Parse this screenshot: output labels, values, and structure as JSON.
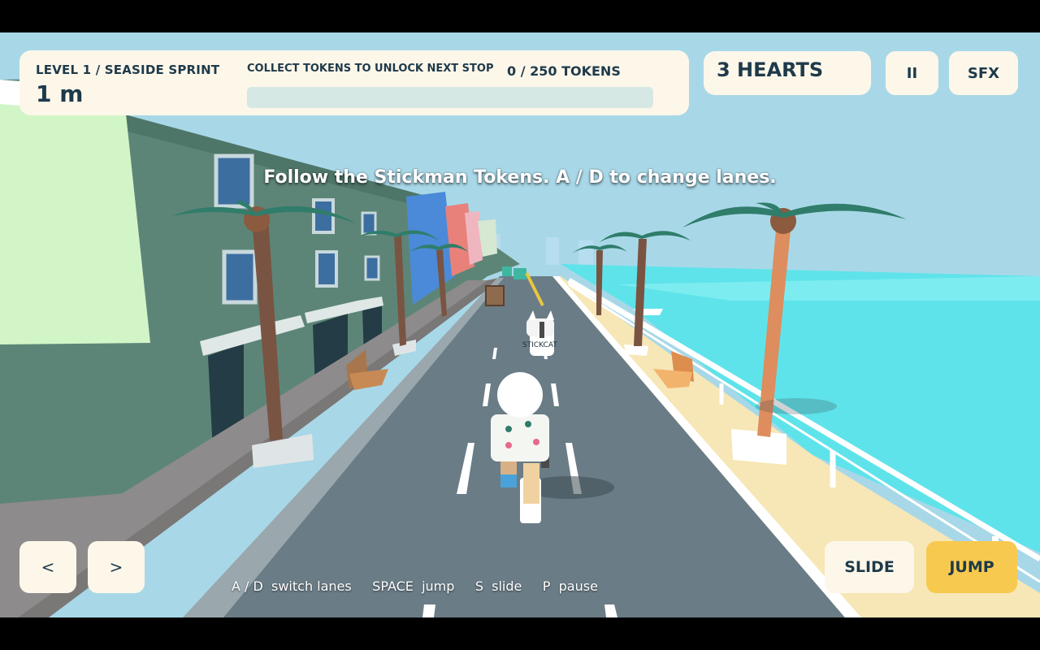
{
  "hud": {
    "level_title": "LEVEL 1 / SEASIDE SPRINT",
    "distance": "1 m",
    "collect_label": "COLLECT TOKENS TO UNLOCK NEXT STOP",
    "tokens": "0 / 250 TOKENS",
    "progress_fraction": 0,
    "hearts": "3 HEARTS"
  },
  "buttons": {
    "pause": "II",
    "sfx": "SFX",
    "left": "<",
    "right": ">",
    "slide": "SLIDE",
    "jump": "JUMP"
  },
  "hint": "Follow the Stickman Tokens. A / D to change lanes.",
  "controls": "A / D  switch lanes     SPACE  jump     S  slide     P  pause",
  "npc_label": "STICKCAT",
  "colors": {
    "panel": "#fdf7ea",
    "panel_text": "#1e3a4a",
    "accent": "#f7c94e",
    "progress_track": "#d6e8e3",
    "sky": "#a8d8e8",
    "sea": "#5fe3ea",
    "road": "#6a7c86"
  }
}
